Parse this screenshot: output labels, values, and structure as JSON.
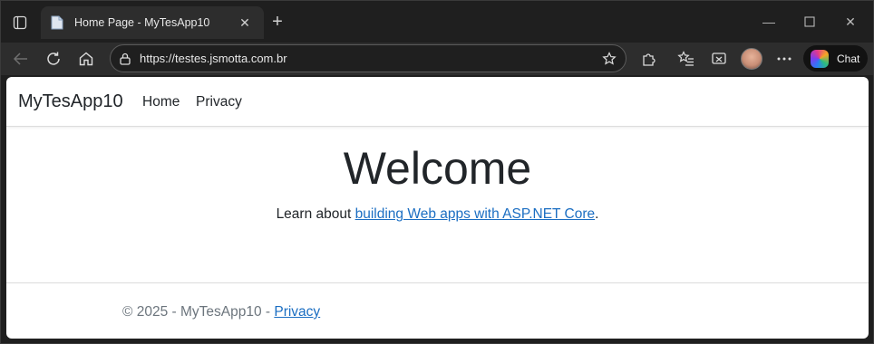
{
  "browser": {
    "tab": {
      "title": "Home Page - MyTesApp10"
    },
    "address_bar": {
      "url": "https://testes.jsmotta.com.br"
    },
    "chat_label": "Chat",
    "accent": "#1b6ec2"
  },
  "site": {
    "brand": "MyTesApp10",
    "nav": [
      {
        "label": "Home"
      },
      {
        "label": "Privacy"
      }
    ],
    "heading": "Welcome",
    "learn_prefix": "Learn about ",
    "learn_link": "building Web apps with ASP.NET Core",
    "learn_suffix": ".",
    "footer": {
      "prefix": "© 2025 - MyTesApp10 - ",
      "link": "Privacy"
    }
  }
}
